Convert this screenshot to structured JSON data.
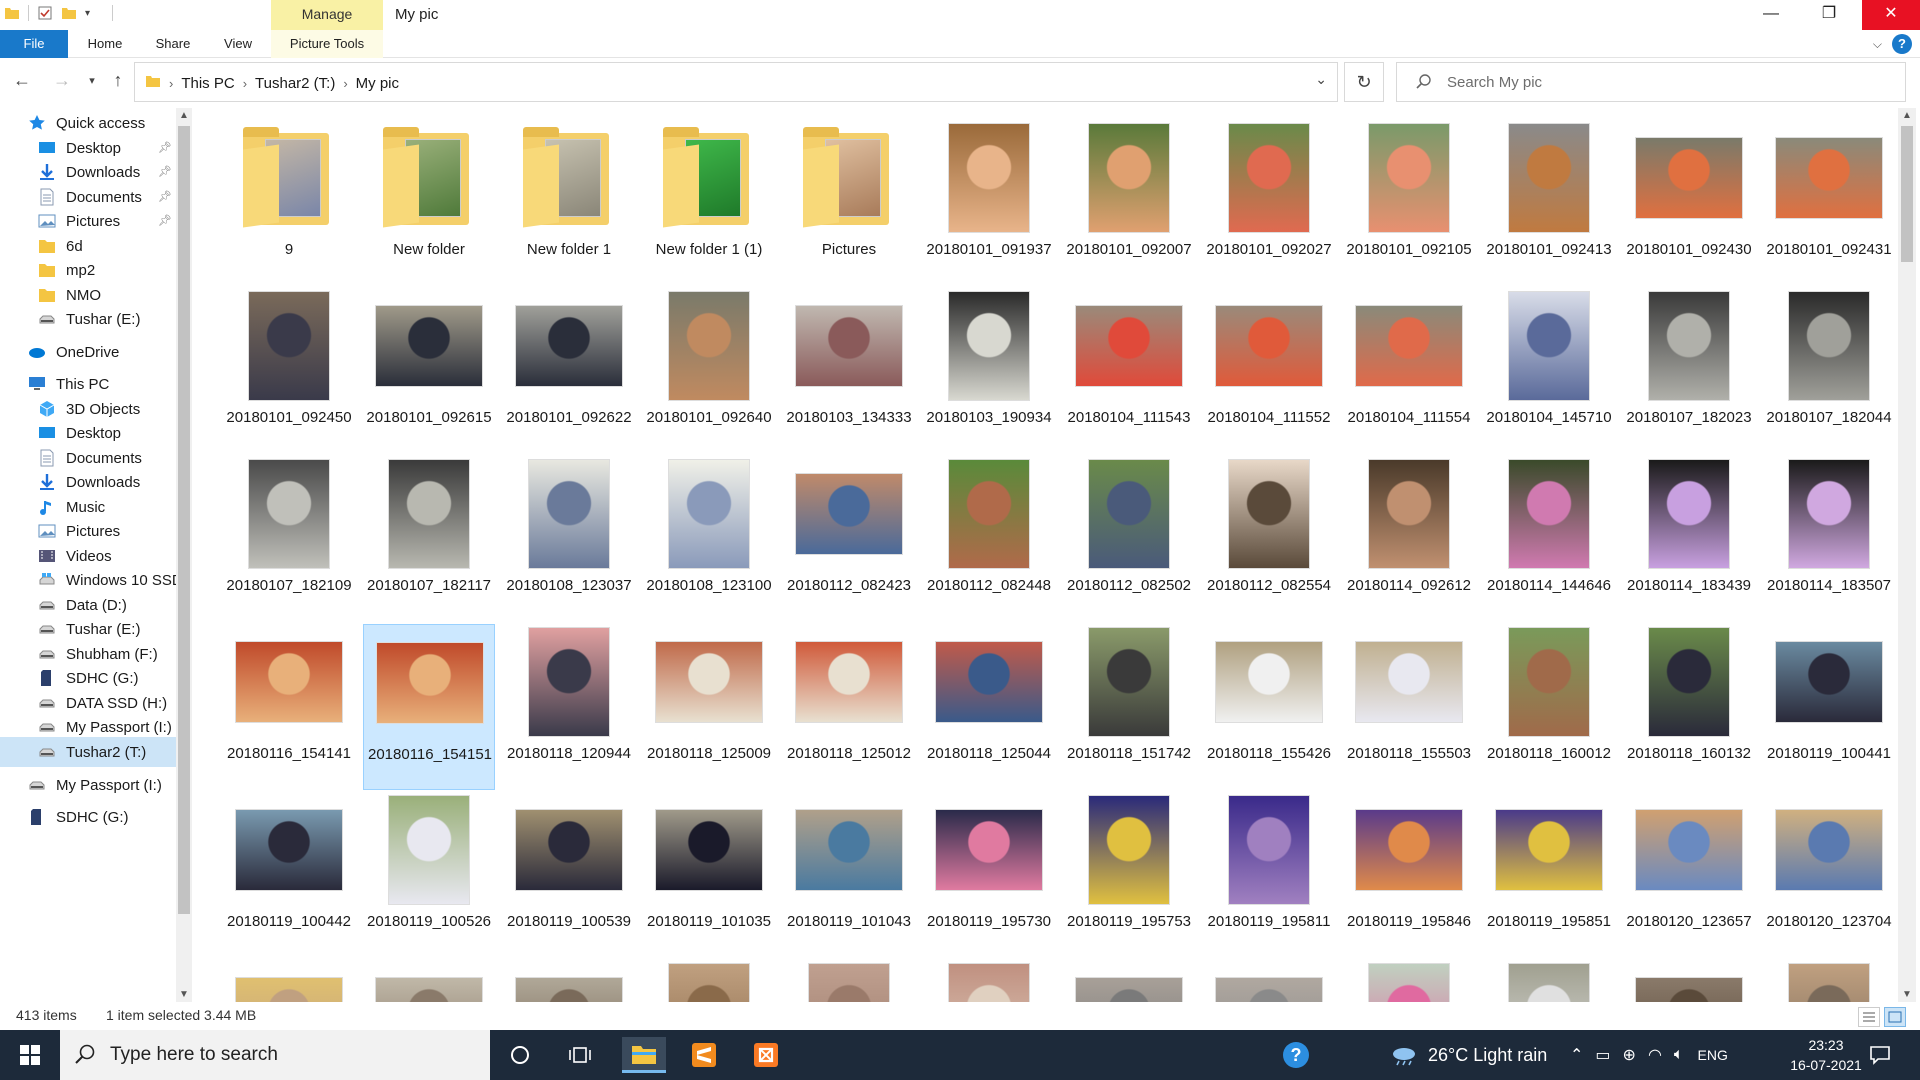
{
  "window": {
    "title": "My pic",
    "context_tab": "Manage",
    "minimize": "—",
    "restore": "❐",
    "close": "✕"
  },
  "ribbon": {
    "tabs": [
      "File",
      "Home",
      "Share",
      "View"
    ],
    "context_subtab": "Picture Tools",
    "help": "?"
  },
  "address": {
    "crumbs": [
      "This PC",
      "Tushar2 (T:)",
      "My pic"
    ],
    "search_placeholder": "Search My pic"
  },
  "nav_pane": {
    "items": [
      {
        "label": "Quick access",
        "icon": "star-icon",
        "level": 0,
        "color": "#1e88e5"
      },
      {
        "label": "Desktop",
        "icon": "desktop-icon",
        "level": 1,
        "pinned": true,
        "color": "#1a8fe3"
      },
      {
        "label": "Downloads",
        "icon": "download-icon",
        "level": 1,
        "pinned": true,
        "color": "#1e6fd9"
      },
      {
        "label": "Documents",
        "icon": "document-icon",
        "level": 1,
        "pinned": true,
        "color": "#8a9ab0"
      },
      {
        "label": "Pictures",
        "icon": "pictures-icon",
        "level": 1,
        "pinned": true,
        "color": "#5f8fbf"
      },
      {
        "label": "6d",
        "icon": "folder-icon",
        "level": 1,
        "color": "#f4c542"
      },
      {
        "label": "mp2",
        "icon": "folder-icon",
        "level": 1,
        "color": "#f4c542"
      },
      {
        "label": "NMO",
        "icon": "folder-icon",
        "level": 1,
        "color": "#f4c542"
      },
      {
        "label": "Tushar (E:)",
        "icon": "drive-icon",
        "level": 1,
        "color": "#888888"
      },
      {
        "label": "OneDrive",
        "icon": "cloud-icon",
        "level": 0,
        "color": "#0078d4"
      },
      {
        "label": "This PC",
        "icon": "pc-icon",
        "level": 0,
        "color": "#2a7fd4"
      },
      {
        "label": "3D Objects",
        "icon": "cube-icon",
        "level": 1,
        "color": "#3fa9f5"
      },
      {
        "label": "Desktop",
        "icon": "desktop-icon",
        "level": 1,
        "color": "#1a8fe3"
      },
      {
        "label": "Documents",
        "icon": "document-icon",
        "level": 1,
        "color": "#8a9ab0"
      },
      {
        "label": "Downloads",
        "icon": "download-icon",
        "level": 1,
        "color": "#1e6fd9"
      },
      {
        "label": "Music",
        "icon": "music-icon",
        "level": 1,
        "color": "#1e88e5"
      },
      {
        "label": "Pictures",
        "icon": "pictures-icon",
        "level": 1,
        "color": "#5f8fbf"
      },
      {
        "label": "Videos",
        "icon": "video-icon",
        "level": 1,
        "color": "#555577"
      },
      {
        "label": "Windows 10 SSD",
        "icon": "windows-drive-icon",
        "level": 1,
        "color": "#3fa9f5"
      },
      {
        "label": "Data (D:)",
        "icon": "drive-icon",
        "level": 1,
        "color": "#888888"
      },
      {
        "label": "Tushar (E:)",
        "icon": "drive-icon",
        "level": 1,
        "color": "#888888"
      },
      {
        "label": "Shubham (F:)",
        "icon": "drive-icon",
        "level": 1,
        "color": "#888888"
      },
      {
        "label": "SDHC (G:)",
        "icon": "sd-card-icon",
        "level": 1,
        "color": "#2b3f6b"
      },
      {
        "label": "DATA SSD (H:)",
        "icon": "drive-icon",
        "level": 1,
        "color": "#888888"
      },
      {
        "label": "My Passport (I:)",
        "icon": "drive-icon",
        "level": 1,
        "color": "#888888"
      },
      {
        "label": "Tushar2 (T:)",
        "icon": "drive-icon",
        "level": 1,
        "selected": true,
        "color": "#888888"
      },
      {
        "label": "My Passport (I:)",
        "icon": "drive-icon",
        "level": 0,
        "color": "#888888"
      },
      {
        "label": "SDHC (G:)",
        "icon": "sd-card-icon",
        "level": 0,
        "color": "#2b3f6b"
      }
    ]
  },
  "files": [
    {
      "label": "9",
      "kind": "folder",
      "c1": "#7a86a8",
      "c2": "#c4b7a5"
    },
    {
      "label": "New folder",
      "kind": "folder",
      "c1": "#4f7a3a",
      "c2": "#9ab07a"
    },
    {
      "label": "New folder 1",
      "kind": "folder",
      "c1": "#8a8678",
      "c2": "#c7c2b0"
    },
    {
      "label": "New folder 1 (1)",
      "kind": "folder",
      "c1": "#1f7a2a",
      "c2": "#3fb84a"
    },
    {
      "label": "Pictures",
      "kind": "folder",
      "c1": "#a87b5a",
      "c2": "#e0c0a0"
    },
    {
      "label": "20180101_091937",
      "kind": "portrait",
      "c1": "#9a6a3a",
      "c2": "#e8b48a"
    },
    {
      "label": "20180101_092007",
      "kind": "portrait",
      "c1": "#5a7a3a",
      "c2": "#e0a070"
    },
    {
      "label": "20180101_092027",
      "kind": "portrait",
      "c1": "#6a8a4a",
      "c2": "#e06a50"
    },
    {
      "label": "20180101_092105",
      "kind": "portrait",
      "c1": "#7a9a6a",
      "c2": "#e89070"
    },
    {
      "label": "20180101_092413",
      "kind": "portrait",
      "c1": "#8a8a8a",
      "c2": "#c07a40"
    },
    {
      "label": "20180101_092430",
      "kind": "landscape",
      "c1": "#7a7a6a",
      "c2": "#e07040"
    },
    {
      "label": "20180101_092431",
      "kind": "landscape",
      "c1": "#8a8a7a",
      "c2": "#e07040"
    },
    {
      "label": "20180101_092450",
      "kind": "portrait",
      "c1": "#7a6a5a",
      "c2": "#3a3a4a"
    },
    {
      "label": "20180101_092615",
      "kind": "landscape",
      "c1": "#a09a8a",
      "c2": "#2a2e3a"
    },
    {
      "label": "20180101_092622",
      "kind": "landscape",
      "c1": "#a0a09a",
      "c2": "#2a2e3a"
    },
    {
      "label": "20180101_092640",
      "kind": "portrait",
      "c1": "#7a7a6a",
      "c2": "#c08a60"
    },
    {
      "label": "20180103_134333",
      "kind": "landscape",
      "c1": "#c0b8b0",
      "c2": "#8a5a5a"
    },
    {
      "label": "20180103_190934",
      "kind": "portrait",
      "c1": "#2a2a2a",
      "c2": "#d8d8d0"
    },
    {
      "label": "20180104_111543",
      "kind": "landscape",
      "c1": "#9a8a7a",
      "c2": "#e04a3a"
    },
    {
      "label": "20180104_111552",
      "kind": "landscape",
      "c1": "#9a8a7a",
      "c2": "#e05a3a"
    },
    {
      "label": "20180104_111554",
      "kind": "landscape",
      "c1": "#8a8a7a",
      "c2": "#e06a4a"
    },
    {
      "label": "20180104_145710",
      "kind": "portrait",
      "c1": "#d8dce8",
      "c2": "#5a6a9a"
    },
    {
      "label": "20180107_182023",
      "kind": "portrait",
      "c1": "#3a3a3a",
      "c2": "#b0b0aa"
    },
    {
      "label": "20180107_182044",
      "kind": "portrait",
      "c1": "#2a2a2a",
      "c2": "#a0a09a"
    },
    {
      "label": "20180107_182109",
      "kind": "portrait",
      "c1": "#4a4a4a",
      "c2": "#c0c0ba"
    },
    {
      "label": "20180107_182117",
      "kind": "portrait",
      "c1": "#3a3a3a",
      "c2": "#b8b8b0"
    },
    {
      "label": "20180108_123037",
      "kind": "portrait",
      "c1": "#e8e8e0",
      "c2": "#6a7a9a"
    },
    {
      "label": "20180108_123100",
      "kind": "portrait",
      "c1": "#f0f0e8",
      "c2": "#8a9aba"
    },
    {
      "label": "20180112_082423",
      "kind": "landscape",
      "c1": "#c08a6a",
      "c2": "#4a6a9a"
    },
    {
      "label": "20180112_082448",
      "kind": "portrait",
      "c1": "#5a8a3a",
      "c2": "#b06a4a"
    },
    {
      "label": "20180112_082502",
      "kind": "portrait",
      "c1": "#6a8a4a",
      "c2": "#4a5a7a"
    },
    {
      "label": "20180112_082554",
      "kind": "portrait",
      "c1": "#e8d8c8",
      "c2": "#5a4a3a"
    },
    {
      "label": "20180114_092612",
      "kind": "portrait",
      "c1": "#4a3a2a",
      "c2": "#c09070"
    },
    {
      "label": "20180114_144646",
      "kind": "portrait",
      "c1": "#3a4a2a",
      "c2": "#d07ab0"
    },
    {
      "label": "20180114_183439",
      "kind": "portrait",
      "c1": "#1a1a1a",
      "c2": "#c8a0e0"
    },
    {
      "label": "20180114_183507",
      "kind": "portrait",
      "c1": "#1a1a1a",
      "c2": "#d0a8e0"
    },
    {
      "label": "20180116_154141",
      "kind": "landscape",
      "c1": "#c04a2a",
      "c2": "#e8b07a"
    },
    {
      "label": "20180116_154151",
      "kind": "landscape",
      "c1": "#c04a2a",
      "c2": "#e8b07a",
      "selected": true
    },
    {
      "label": "20180118_120944",
      "kind": "portrait",
      "c1": "#e0a0a0",
      "c2": "#3a3a4a"
    },
    {
      "label": "20180118_125009",
      "kind": "landscape",
      "c1": "#c06a4a",
      "c2": "#e8e0d0"
    },
    {
      "label": "20180118_125012",
      "kind": "landscape",
      "c1": "#d05a3a",
      "c2": "#e8e0d0"
    },
    {
      "label": "20180118_125044",
      "kind": "landscape",
      "c1": "#c05a4a",
      "c2": "#3a5a8a"
    },
    {
      "label": "20180118_151742",
      "kind": "portrait",
      "c1": "#8a9a6a",
      "c2": "#3a3a3a"
    },
    {
      "label": "20180118_155426",
      "kind": "landscape",
      "c1": "#b0a080",
      "c2": "#f0f0f0"
    },
    {
      "label": "20180118_155503",
      "kind": "landscape",
      "c1": "#c0b090",
      "c2": "#e8e8f0"
    },
    {
      "label": "20180118_160012",
      "kind": "portrait",
      "c1": "#7a9a5a",
      "c2": "#a06a4a"
    },
    {
      "label": "20180118_160132",
      "kind": "portrait",
      "c1": "#6a8a4a",
      "c2": "#2a2a3a"
    },
    {
      "label": "20180119_100441",
      "kind": "landscape",
      "c1": "#6a8aa0",
      "c2": "#2a2a3a"
    },
    {
      "label": "20180119_100442",
      "kind": "landscape",
      "c1": "#7a9ab0",
      "c2": "#2a2a3a"
    },
    {
      "label": "20180119_100526",
      "kind": "portrait",
      "c1": "#9ab07a",
      "c2": "#e8e8f0"
    },
    {
      "label": "20180119_100539",
      "kind": "landscape",
      "c1": "#a09070",
      "c2": "#2a2a3a"
    },
    {
      "label": "20180119_101035",
      "kind": "landscape",
      "c1": "#a09a8a",
      "c2": "#1a1a2a"
    },
    {
      "label": "20180119_101043",
      "kind": "landscape",
      "c1": "#b0a08a",
      "c2": "#4a7aa0"
    },
    {
      "label": "20180119_195730",
      "kind": "landscape",
      "c1": "#2a2a4a",
      "c2": "#e07aa0"
    },
    {
      "label": "20180119_195753",
      "kind": "portrait",
      "c1": "#2a2a7a",
      "c2": "#e0c040"
    },
    {
      "label": "20180119_195811",
      "kind": "portrait",
      "c1": "#3a2a8a",
      "c2": "#a080c0"
    },
    {
      "label": "20180119_195846",
      "kind": "landscape",
      "c1": "#5a3a8a",
      "c2": "#e08a4a"
    },
    {
      "label": "20180119_195851",
      "kind": "landscape",
      "c1": "#4a3a8a",
      "c2": "#e0c040"
    },
    {
      "label": "20180120_123657",
      "kind": "landscape",
      "c1": "#d0a070",
      "c2": "#6a8ac0"
    },
    {
      "label": "20180120_123704",
      "kind": "landscape",
      "c1": "#d0b080",
      "c2": "#5a7ab0"
    },
    {
      "label": "",
      "kind": "landscape",
      "c1": "#e0c070",
      "c2": "#c0a080"
    },
    {
      "label": "",
      "kind": "landscape",
      "c1": "#c0b8a8",
      "c2": "#8a7a6a"
    },
    {
      "label": "",
      "kind": "landscape",
      "c1": "#b0a898",
      "c2": "#7a6a5a"
    },
    {
      "label": "",
      "kind": "portrait",
      "c1": "#c0a080",
      "c2": "#8a6a4a"
    },
    {
      "label": "",
      "kind": "portrait",
      "c1": "#c0a090",
      "c2": "#9a7a6a"
    },
    {
      "label": "",
      "kind": "portrait",
      "c1": "#c09080",
      "c2": "#e0d0c0"
    },
    {
      "label": "",
      "kind": "landscape",
      "c1": "#a8a098",
      "c2": "#7a7a7a"
    },
    {
      "label": "",
      "kind": "landscape",
      "c1": "#b0a8a0",
      "c2": "#8a8a8a"
    },
    {
      "label": "",
      "kind": "portrait",
      "c1": "#c0d0c0",
      "c2": "#e06aa0"
    },
    {
      "label": "",
      "kind": "portrait",
      "c1": "#a0a090",
      "c2": "#e0e0e0"
    },
    {
      "label": "",
      "kind": "landscape",
      "c1": "#8a7a6a",
      "c2": "#5a4a3a"
    },
    {
      "label": "",
      "kind": "portrait",
      "c1": "#c0a080",
      "c2": "#7a6a5a"
    }
  ],
  "status": {
    "count": "413 items",
    "selection": "1 item selected  3.44 MB"
  },
  "taskbar": {
    "search_placeholder": "Type here to search",
    "weather": "26°C  Light rain",
    "language": "ENG",
    "time": "23:23",
    "date": "16-07-2021"
  }
}
